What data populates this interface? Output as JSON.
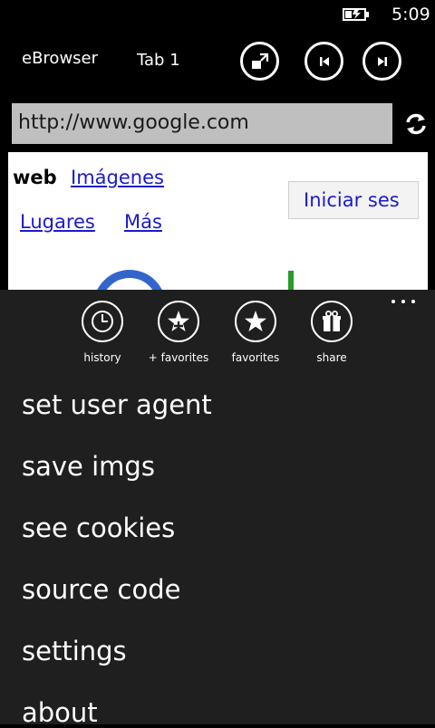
{
  "status_bar": {
    "time": "5:09",
    "battery_icon": "battery-charging-icon"
  },
  "app_bar": {
    "title": "eBrowser",
    "tab_label": "Tab 1",
    "buttons": [
      "fullscreen-icon",
      "previous-icon",
      "next-icon"
    ]
  },
  "address_bar": {
    "url": "http://www.google.com",
    "refresh_icon": "refresh-icon"
  },
  "webpage": {
    "nav_current": "web",
    "links": [
      "Imágenes",
      "Lugares",
      "Más"
    ],
    "signin_button": "Iniciar ses"
  },
  "app_menu": {
    "more_icon": "ellipsis-icon",
    "actions": [
      {
        "label": "history",
        "icon": "clock-icon"
      },
      {
        "label": "+ favorites",
        "icon": "add-star-icon"
      },
      {
        "label": "favorites",
        "icon": "star-icon"
      },
      {
        "label": "share",
        "icon": "gift-icon"
      }
    ],
    "items": [
      "set user agent",
      "save imgs",
      "see cookies",
      "source code",
      "settings",
      "about"
    ]
  }
}
